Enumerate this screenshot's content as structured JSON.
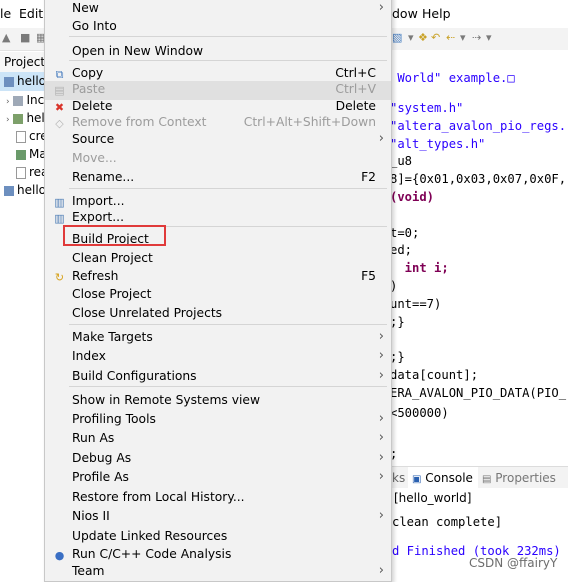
{
  "menubar": {
    "items": [
      "le",
      "Edit",
      "dow",
      "Help"
    ]
  },
  "project_explorer": {
    "tab_label": "Project",
    "items": [
      "hello",
      "Inc",
      "hel",
      "cre",
      "Ma",
      "rea",
      "hello_"
    ]
  },
  "editor": {
    "lines": [
      " World\" example.□",
      "",
      "\"system.h\"",
      "\"altera_avalon_pio_regs.",
      "\"alt_types.h\"",
      "_u8",
      "8]={0x01,0x03,0x07,0x0F,",
      "(void)",
      "",
      "t=0;",
      "ed;",
      "  int i;",
      ")",
      "unt==7)",
      ";}",
      "",
      ";}",
      "data[count];",
      "ERA_AVALON_PIO_DATA(PIO_",
      "",
      "<500000)",
      "",
      "",
      ";"
    ]
  },
  "bottom_panel": {
    "tab_left": "ks",
    "tab_console": "Console",
    "tab_console_close": "⊗",
    "tab_properties": "Properties",
    "console_lines": [
      "[hello_world]",
      "",
      "clean complete]",
      "",
      "d Finished (took 232ms)"
    ]
  },
  "watermark": "CSDN @ffairyY",
  "context_menu": {
    "items": [
      {
        "label": "New",
        "arrow": true
      },
      {
        "label": "Go Into"
      },
      {
        "sep": true
      },
      {
        "label": "Open in New Window"
      },
      {
        "sep": true
      },
      {
        "label": "Copy",
        "accel": "Ctrl+C",
        "icon": "copy-icon"
      },
      {
        "label": "Paste",
        "accel": "Ctrl+V",
        "icon": "paste-icon",
        "disabled": true,
        "highlight": true
      },
      {
        "label": "Delete",
        "accel": "Delete",
        "icon": "delete-icon"
      },
      {
        "label": "Remove from Context",
        "accel": "Ctrl+Alt+Shift+Down",
        "icon": "remove-context-icon",
        "disabled": true
      },
      {
        "label": "Source",
        "arrow": true
      },
      {
        "label": "Move...",
        "disabled": true
      },
      {
        "label": "Rename...",
        "accel": "F2"
      },
      {
        "sep": true
      },
      {
        "label": "Import...",
        "icon": "import-icon"
      },
      {
        "label": "Export...",
        "icon": "export-icon"
      },
      {
        "sep": true
      },
      {
        "label": "Build Project",
        "boxed": true
      },
      {
        "label": "Clean Project"
      },
      {
        "label": "Refresh",
        "accel": "F5",
        "icon": "refresh-icon"
      },
      {
        "label": "Close Project"
      },
      {
        "label": "Close Unrelated Projects"
      },
      {
        "sep": true
      },
      {
        "label": "Make Targets",
        "arrow": true
      },
      {
        "label": "Index",
        "arrow": true
      },
      {
        "label": "Build Configurations",
        "arrow": true
      },
      {
        "sep": true
      },
      {
        "label": "Show in Remote Systems view"
      },
      {
        "label": "Profiling Tools",
        "arrow": true
      },
      {
        "label": "Run As",
        "arrow": true
      },
      {
        "label": "Debug As",
        "arrow": true
      },
      {
        "label": "Profile As",
        "arrow": true
      },
      {
        "label": "Restore from Local History..."
      },
      {
        "label": "Nios II",
        "arrow": true
      },
      {
        "label": "Update Linked Resources"
      },
      {
        "label": "Run C/C++ Code Analysis",
        "icon": "code-analysis-icon"
      },
      {
        "label": "Team",
        "arrow": true
      }
    ]
  },
  "colors": {
    "menu_bg": "#f2f2f2",
    "highlight_box": "#e03a3a",
    "string_color": "#2a00ff",
    "keyword_color": "#7f0055"
  }
}
